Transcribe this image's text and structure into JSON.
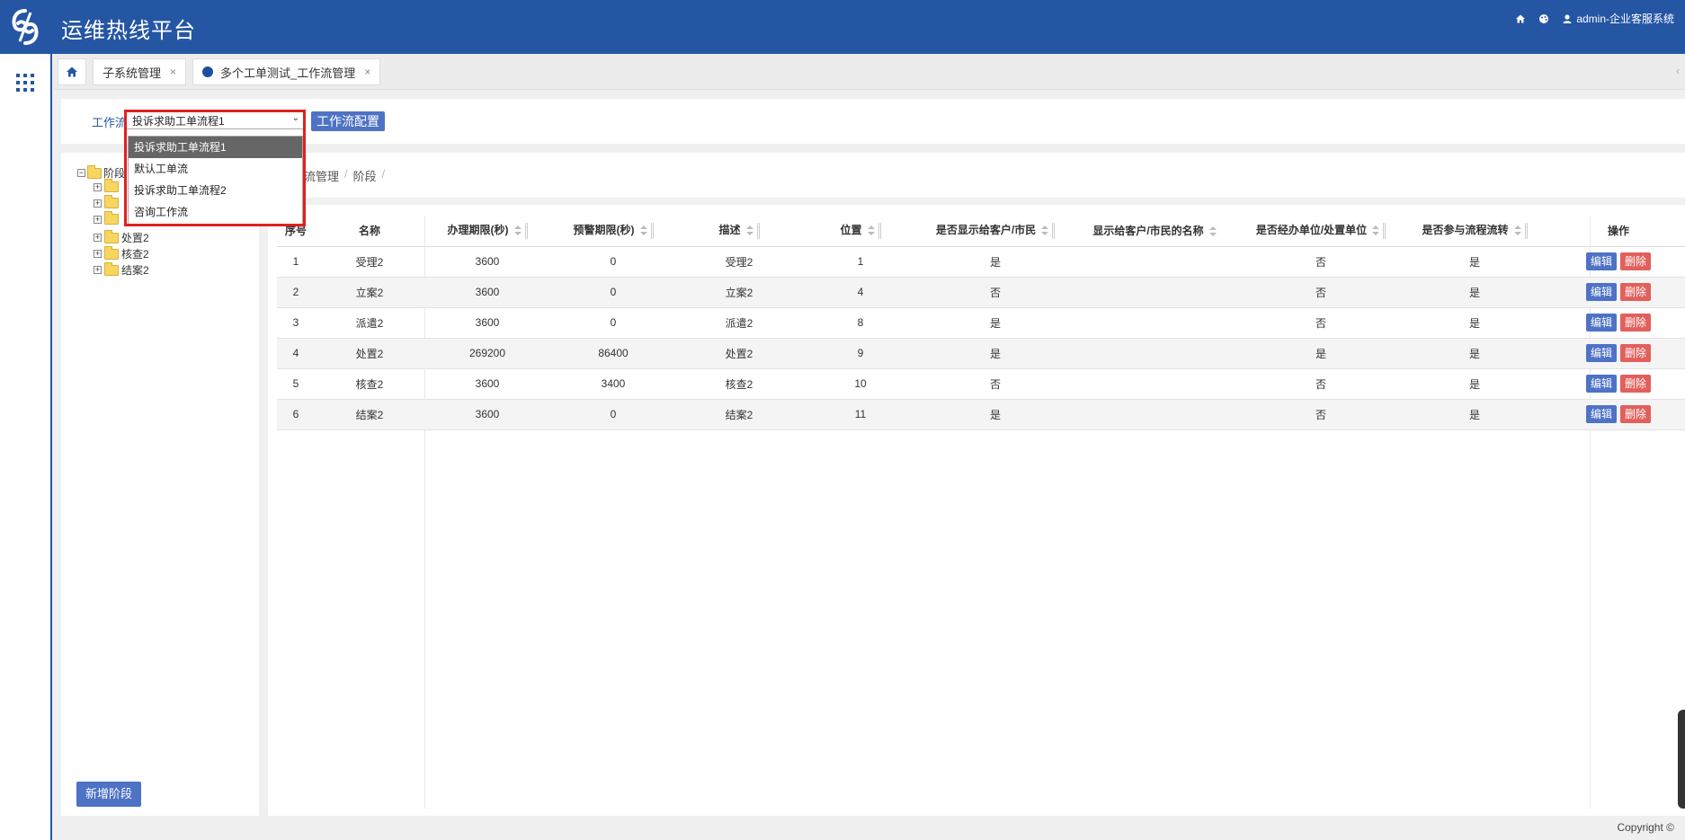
{
  "header": {
    "app_title": "运维热线平台",
    "user": "admin-企业客服系统",
    "home_icon": "home-icon",
    "theme_icon": "palette-icon",
    "user_icon": "user-icon"
  },
  "tabs": {
    "items": [
      {
        "label": "子系统管理",
        "close": "×"
      },
      {
        "label": "多个工单测试_工作流管理",
        "close": "×"
      }
    ],
    "collapse": "‹"
  },
  "workflow": {
    "label": "工作流",
    "selected": "投诉求助工单流程1",
    "config_button": "工作流配置",
    "options": [
      "投诉求助工单流程1",
      "默认工单流",
      "投诉求助工单流程2",
      "咨询工作流"
    ]
  },
  "tree": {
    "root": "阶段",
    "visible_nodes": [
      "处置2",
      "核查2",
      "结案2"
    ],
    "add_button": "新增阶段"
  },
  "breadcrumb": [
    "流管理",
    "阶段"
  ],
  "table": {
    "headers": [
      "序号",
      "名称",
      "办理期限(秒)",
      "预警期限(秒)",
      "描述",
      "位置",
      "是否显示给客户/市民",
      "显示给客户/市民的名称",
      "是否经办单位/处置单位",
      "是否参与流程流转",
      "操作"
    ],
    "rows": [
      [
        "1",
        "受理2",
        "3600",
        "0",
        "受理2",
        "1",
        "是",
        "",
        "否",
        "是"
      ],
      [
        "2",
        "立案2",
        "3600",
        "0",
        "立案2",
        "4",
        "否",
        "",
        "否",
        "是"
      ],
      [
        "3",
        "派遣2",
        "3600",
        "0",
        "派遣2",
        "8",
        "是",
        "",
        "否",
        "是"
      ],
      [
        "4",
        "处置2",
        "269200",
        "86400",
        "处置2",
        "9",
        "是",
        "",
        "是",
        "是"
      ],
      [
        "5",
        "核查2",
        "3600",
        "3400",
        "核查2",
        "10",
        "否",
        "",
        "否",
        "是"
      ],
      [
        "6",
        "结案2",
        "3600",
        "0",
        "结案2",
        "11",
        "是",
        "",
        "否",
        "是"
      ]
    ],
    "edit_label": "编辑",
    "delete_label": "删除"
  },
  "footer": {
    "copyright": "Copyright ©"
  },
  "colors": {
    "primary": "#2556a4",
    "button": "#4e72c4",
    "danger": "#e2605c",
    "highlight": "#e02020"
  }
}
